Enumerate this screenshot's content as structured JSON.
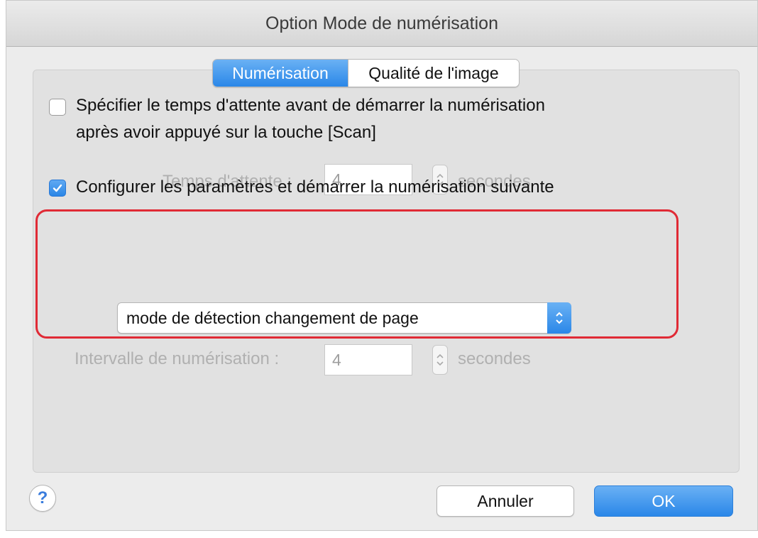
{
  "window": {
    "title": "Option Mode de numérisation"
  },
  "tabs": [
    {
      "label": "Numérisation",
      "selected": true
    },
    {
      "label": "Qualité de l'image",
      "selected": false
    }
  ],
  "wait_option": {
    "checked": false,
    "label_line1": "Spécifier le temps d'attente avant de démarrer la numérisation",
    "label_line2": "après avoir appuyé sur la touche [Scan]",
    "field_label": "Temps d'attente :",
    "value": "4",
    "unit": "secondes"
  },
  "next_scan_option": {
    "checked": true,
    "label": "Configurer les paramètres et démarrer la numérisation suivante",
    "mode_selected": "mode de détection changement de page",
    "interval_label": "Intervalle de numérisation :",
    "interval_value": "4",
    "interval_unit": "secondes"
  },
  "buttons": {
    "help": "?",
    "cancel": "Annuler",
    "ok": "OK"
  },
  "colors": {
    "accent": "#2a87e8",
    "highlight": "#e02a35"
  }
}
